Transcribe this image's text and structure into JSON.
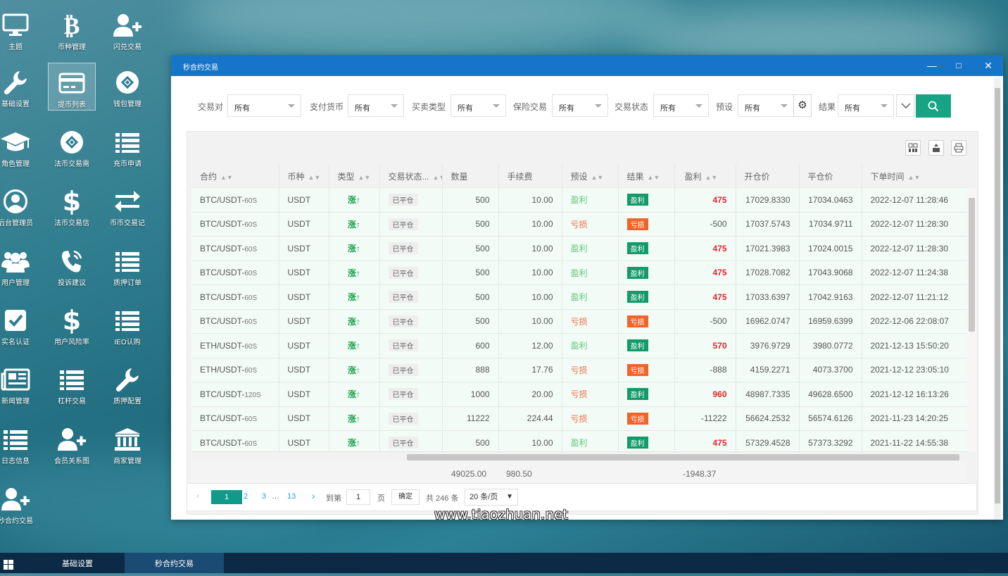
{
  "desktop": {
    "icons": [
      {
        "label": "主题",
        "icon": "monitor-icon"
      },
      {
        "label": "币种管理",
        "icon": "bitcoin-icon"
      },
      {
        "label": "闪兑交易",
        "icon": "user-plus-icon"
      },
      {
        "label": "基础设置",
        "icon": "wrench-icon"
      },
      {
        "label": "提币列表",
        "icon": "card-icon",
        "selected": true
      },
      {
        "label": "钱包管理",
        "icon": "diamond-icon"
      },
      {
        "label": "角色管理",
        "icon": "graduation-cap-icon"
      },
      {
        "label": "法币交易需",
        "icon": "diamond-icon"
      },
      {
        "label": "充币申请",
        "icon": "list-icon"
      },
      {
        "label": "后台管理员",
        "icon": "user-circle-icon"
      },
      {
        "label": "法币交易信",
        "icon": "dollar-icon"
      },
      {
        "label": "币币交易记",
        "icon": "exchange-icon"
      },
      {
        "label": "用户管理",
        "icon": "users-icon"
      },
      {
        "label": "投诉建议",
        "icon": "phone-icon"
      },
      {
        "label": "质押订单",
        "icon": "list-icon"
      },
      {
        "label": "实名认证",
        "icon": "check-box-icon"
      },
      {
        "label": "用户风险率",
        "icon": "dollar-icon"
      },
      {
        "label": "IEO认购",
        "icon": "list-icon"
      },
      {
        "label": "新闻管理",
        "icon": "newspaper-icon"
      },
      {
        "label": "杠杆交易",
        "icon": "list-icon"
      },
      {
        "label": "质押配置",
        "icon": "wrench-icon"
      },
      {
        "label": "日志信息",
        "icon": "list-icon"
      },
      {
        "label": "会员关系图",
        "icon": "user-plus-icon"
      },
      {
        "label": "商家管理",
        "icon": "bank-icon"
      },
      {
        "label": "秒合约交易",
        "icon": "user-plus-icon"
      }
    ]
  },
  "window": {
    "title": "秒合约交易",
    "controls": {
      "minimize": "—",
      "maximize": "□",
      "close": "✕"
    }
  },
  "filters": [
    {
      "label": "交易对",
      "value": "所有"
    },
    {
      "label": "支付货币",
      "value": "所有"
    },
    {
      "label": "买卖类型",
      "value": "所有"
    },
    {
      "label": "保险交易",
      "value": "所有"
    },
    {
      "label": "交易状态",
      "value": "所有"
    },
    {
      "label": "预设",
      "value": "所有"
    },
    {
      "label": "结果",
      "value": "所有"
    }
  ],
  "table": {
    "columns": [
      "合约",
      "币种",
      "类型",
      "交易状态...",
      "数量",
      "手续费",
      "预设",
      "结果",
      "盈利",
      "开仓价",
      "平仓价",
      "下单时间"
    ],
    "rows": [
      {
        "pair": "BTC/USDT-",
        "period": "60S",
        "coin": "USDT",
        "type": "涨↑",
        "status": "已平仓",
        "qty": "500",
        "fee": "10.00",
        "preset": "盈利",
        "result": "盈利",
        "pnl": "475",
        "open": "17029.8330",
        "close": "17034.0463",
        "time": "2022-12-07 11:28:46"
      },
      {
        "pair": "BTC/USDT-",
        "period": "60S",
        "coin": "USDT",
        "type": "涨↑",
        "status": "已平仓",
        "qty": "500",
        "fee": "10.00",
        "preset": "亏损",
        "result": "亏损",
        "pnl": "-500",
        "open": "17037.5743",
        "close": "17034.9711",
        "time": "2022-12-07 11:28:30"
      },
      {
        "pair": "BTC/USDT-",
        "period": "60S",
        "coin": "USDT",
        "type": "涨↑",
        "status": "已平仓",
        "qty": "500",
        "fee": "10.00",
        "preset": "盈利",
        "result": "盈利",
        "pnl": "475",
        "open": "17021.3983",
        "close": "17024.0015",
        "time": "2022-12-07 11:28:30"
      },
      {
        "pair": "BTC/USDT-",
        "period": "60S",
        "coin": "USDT",
        "type": "涨↑",
        "status": "已平仓",
        "qty": "500",
        "fee": "10.00",
        "preset": "盈利",
        "result": "盈利",
        "pnl": "475",
        "open": "17028.7082",
        "close": "17043.9068",
        "time": "2022-12-07 11:24:38"
      },
      {
        "pair": "BTC/USDT-",
        "period": "60S",
        "coin": "USDT",
        "type": "涨↑",
        "status": "已平仓",
        "qty": "500",
        "fee": "10.00",
        "preset": "盈利",
        "result": "盈利",
        "pnl": "475",
        "open": "17033.6397",
        "close": "17042.9163",
        "time": "2022-12-07 11:21:12"
      },
      {
        "pair": "BTC/USDT-",
        "period": "60S",
        "coin": "USDT",
        "type": "涨↑",
        "status": "已平仓",
        "qty": "500",
        "fee": "10.00",
        "preset": "亏损",
        "result": "亏损",
        "pnl": "-500",
        "open": "16962.0747",
        "close": "16959.6399",
        "time": "2022-12-06 22:08:07"
      },
      {
        "pair": "ETH/USDT-",
        "period": "60S",
        "coin": "USDT",
        "type": "涨↑",
        "status": "已平仓",
        "qty": "600",
        "fee": "12.00",
        "preset": "盈利",
        "result": "盈利",
        "pnl": "570",
        "open": "3976.9729",
        "close": "3980.0772",
        "time": "2021-12-13 15:50:20"
      },
      {
        "pair": "ETH/USDT-",
        "period": "60S",
        "coin": "USDT",
        "type": "涨↑",
        "status": "已平仓",
        "qty": "888",
        "fee": "17.76",
        "preset": "亏损",
        "result": "亏损",
        "pnl": "-888",
        "open": "4159.2271",
        "close": "4073.3700",
        "time": "2021-12-12 23:05:10"
      },
      {
        "pair": "BTC/USDT-",
        "period": "120S",
        "coin": "USDT",
        "type": "涨↑",
        "status": "已平仓",
        "qty": "1000",
        "fee": "20.00",
        "preset": "亏损",
        "result": "盈利",
        "pnl": "960",
        "open": "48987.7335",
        "close": "49628.6500",
        "time": "2021-12-12 16:13:26"
      },
      {
        "pair": "BTC/USDT-",
        "period": "60S",
        "coin": "USDT",
        "type": "涨↑",
        "status": "已平仓",
        "qty": "11222",
        "fee": "224.44",
        "preset": "亏损",
        "result": "亏损",
        "pnl": "-11222",
        "open": "56624.2532",
        "close": "56574.6126",
        "time": "2021-11-23 14:20:25"
      },
      {
        "pair": "BTC/USDT-",
        "period": "60S",
        "coin": "USDT",
        "type": "涨↑",
        "status": "已平仓",
        "qty": "500",
        "fee": "10.00",
        "preset": "盈利",
        "result": "盈利",
        "pnl": "475",
        "open": "57329.4528",
        "close": "57373.3292",
        "time": "2021-11-22 14:55:38"
      }
    ],
    "totals": {
      "qty": "49025.00",
      "fee": "980.50",
      "pnl": "-1948.37"
    }
  },
  "pager": {
    "prev": "‹",
    "current": "1",
    "pages": [
      "2",
      "3"
    ],
    "ellipsis": "…",
    "last": "13",
    "next": "›",
    "goto_label": "到第",
    "goto_value": "1",
    "page_unit": "页",
    "confirm": "确定",
    "total": "共 246 条",
    "page_size": "20 条/页"
  },
  "watermark": "www.tiaozhuan.net",
  "taskbar": {
    "items": [
      "基础设置",
      "秒合约交易"
    ]
  },
  "colors": {
    "titlebar": "#1775c9",
    "accent": "#17a485",
    "win": "#129a6b",
    "loss": "#f0642a",
    "pnl_pos": "#e0262b"
  }
}
